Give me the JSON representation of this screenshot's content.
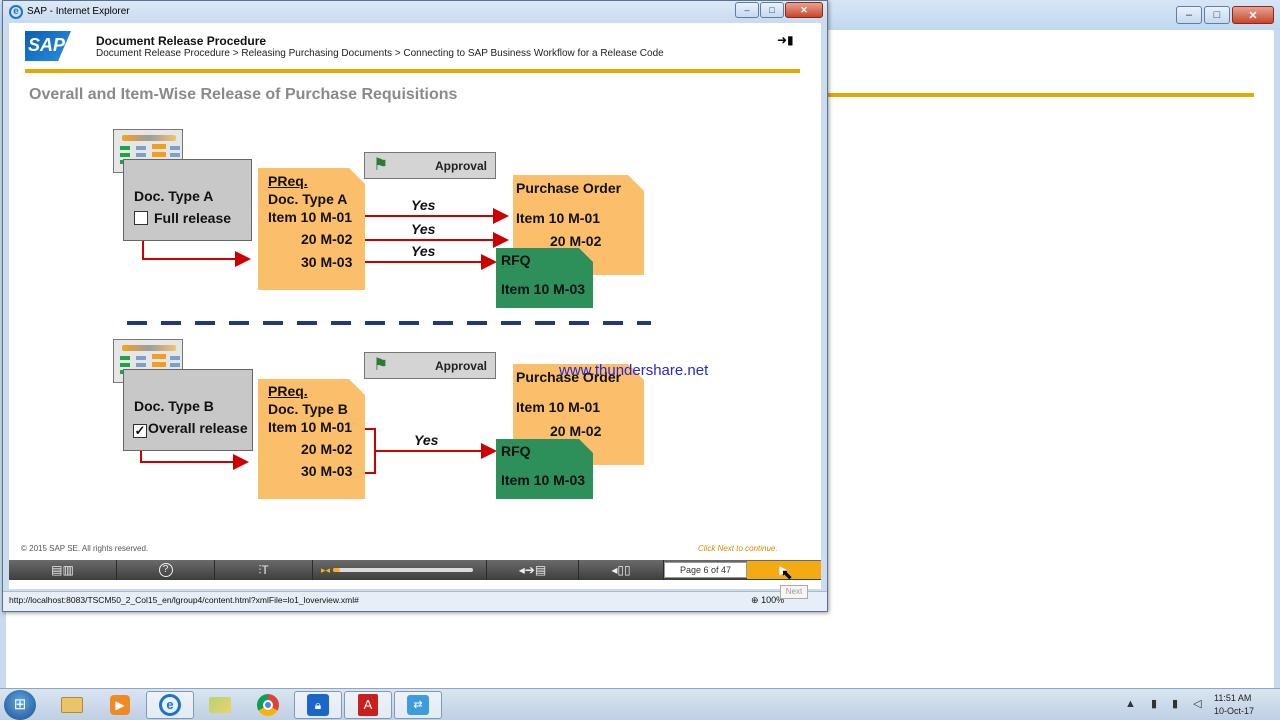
{
  "popup": {
    "title": "SAP - Internet Explorer",
    "caption": {
      "minimize": "–",
      "maximize": "□",
      "close": "✕"
    }
  },
  "course": {
    "logo_text": "SAP",
    "title": "Document Release Procedure",
    "breadcrumb": "Document Release Procedure > Releasing Purchasing Documents > Connecting to SAP Business Workflow for a Release Code",
    "exit_icon": "➜▮"
  },
  "slide": {
    "heading": "Overall and Item-Wise Release of Purchase Requisitions",
    "top": {
      "doc_type": "Doc. Type A",
      "release_label": "Full release",
      "release_checked": "",
      "approval": "Approval",
      "preq_title": "PReq.",
      "preq_doc_type": "Doc. Type A",
      "preq_item1": "Item 10 M-01",
      "preq_item2": "20 M-02",
      "preq_item3": "30 M-03",
      "yes1": "Yes",
      "yes2": "Yes",
      "yes3": "Yes",
      "po_title": "Purchase Order",
      "po_item1": "Item 10 M-01",
      "po_item2": "20 M-02",
      "rfq_title": "RFQ",
      "rfq_item": "Item 10 M-03"
    },
    "bottom": {
      "doc_type": "Doc. Type B",
      "release_label": "Overall release",
      "release_checked": "✓",
      "approval": "Approval",
      "preq_title": "PReq.",
      "preq_doc_type": "Doc. Type B",
      "preq_item1": "Item 10 M-01",
      "preq_item2": "20 M-02",
      "preq_item3": "30 M-03",
      "yes": "Yes",
      "po_title": "Purchase Order",
      "po_item1": "Item 10 M-01",
      "po_item2": "20 M-02",
      "rfq_title": "RFQ",
      "rfq_item": "Item 10 M-03"
    },
    "watermark": "www.thundershare.net"
  },
  "footer": {
    "copyright": "© 2015 SAP SE. All rights reserved.",
    "click_next": "Click Next to continue."
  },
  "player": {
    "toc_icon": "▤▥",
    "help_icon": "?",
    "tools_icon": "⫶T",
    "rewind_icon": "▸◂",
    "progress": 0.05,
    "audio_icon": "◂➔▤",
    "back_icon": "◂▯▯",
    "page_counter": "Page 6 of 47",
    "next_icon": "▶"
  },
  "status": {
    "url": "http://localhost:8083/TSCM50_2_Col15_en/lgroup4/content.html?xmlFile=lo1_loverview.xml#",
    "zoom": "100%",
    "tooltip": "Next"
  },
  "taskbar": {
    "start_icon": "⊞",
    "apps": [
      "folder",
      "media",
      "ie",
      "explorer",
      "chrome",
      "security",
      "pdf",
      "network"
    ],
    "tray_icons": "▲ ▮ ▮ ◁",
    "time": "11:51 AM",
    "date": "10-Oct-17"
  },
  "colors": {
    "accent_gold": "#e4a800",
    "note_orange": "#fbbf6c",
    "rfq_green": "#2d8f5a",
    "arrow_red": "#cc0000",
    "divider_blue": "#1f3a7a"
  }
}
